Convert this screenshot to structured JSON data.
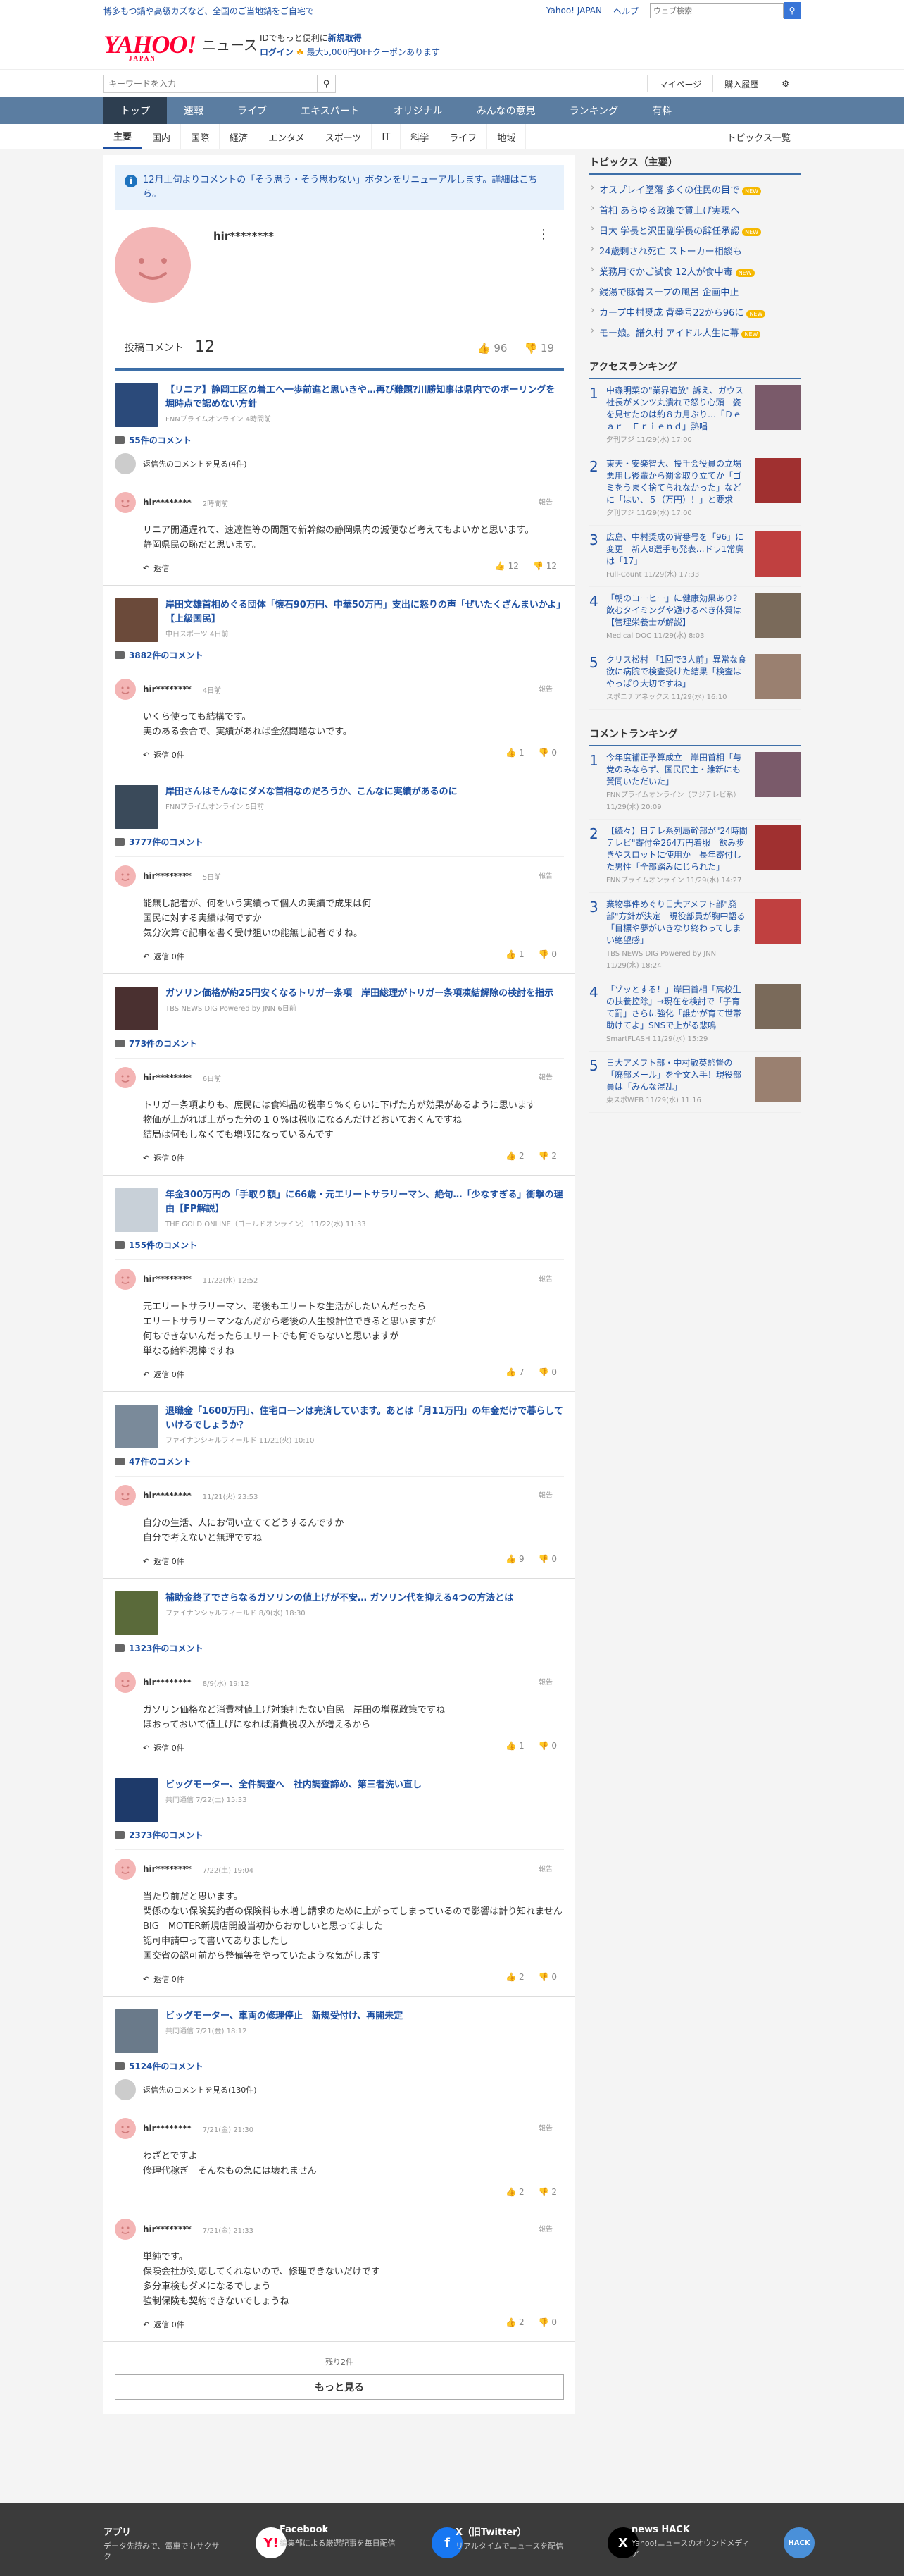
{
  "promo": {
    "left": "博多もつ鍋や高級カズなど、全国のご当地鍋をご自宅で",
    "yahoo_japan": "Yahoo! JAPAN",
    "help": "ヘルプ",
    "search_placeholder": "ウェブ検索"
  },
  "header": {
    "logo": "YAHOO!",
    "logo_sub": "JAPAN",
    "news": "ニュース",
    "line1_a": "IDでもっと便利に",
    "line1_b": "新規取得",
    "login": "ログイン",
    "coupon": "最大5,000円OFFクーポンあります"
  },
  "toolbar": {
    "keyword_placeholder": "キーワードを入力",
    "mypage": "マイページ",
    "history": "購入履歴"
  },
  "gnav": [
    "トップ",
    "速報",
    "ライブ",
    "エキスパート",
    "オリジナル",
    "みんなの意見",
    "ランキング",
    "有料"
  ],
  "subnav": [
    "主要",
    "国内",
    "国際",
    "経済",
    "エンタメ",
    "スポーツ",
    "IT",
    "科学",
    "ライフ",
    "地域"
  ],
  "subnav_right": "トピックス一覧",
  "notice": "12月上旬よりコメントの「そう思う・そう思わない」ボタンをリニューアルします。詳細はこちら。",
  "user": {
    "name": "hir********",
    "count_label": "投稿コメント",
    "count": "12",
    "up": "96",
    "down": "19"
  },
  "articles": [
    {
      "title": "【リニア】静岡工区の着工へ一歩前進と思いきや…再び難題?川勝知事は県内でのボーリングを堀時点で認めない方針",
      "source": "FNNプライムオンライン 4時間前",
      "ccount": "55件のコメント",
      "more": "返信先のコメントを見る(4件)",
      "time": "2時間前",
      "body": "リニア開通遅れて、速達性等の問題で新幹線の静岡県内の減便など考えてもよいかと思います。\n静岡県民の恥だと思います。",
      "reply": "返信",
      "up": "12",
      "down": "12",
      "thumb": "#2b4a7a"
    },
    {
      "title": "岸田文雄首相めぐる団体「懐石90万円、中華50万円」支出に怒りの声「ぜいたくざんまいかよ」【上級国民】",
      "source": "中日スポーツ 4日前",
      "ccount": "3882件のコメント",
      "more": "",
      "time": "4日前",
      "body": "いくら使っても結構です。\n実のある会合で、実績があれば全然問題ないです。",
      "reply": "返信 0件",
      "up": "1",
      "down": "0",
      "thumb": "#6b4a3a"
    },
    {
      "title": "岸田さんはそんなにダメな首相なのだろうか、こんなに実績があるのに",
      "source": "FNNプライムオンライン 5日前",
      "ccount": "3777件のコメント",
      "more": "",
      "time": "5日前",
      "body": "能無し記者が、何をいう実績って個人の実績で成果は何\n国民に対する実績は何ですか\n気分次第で記事を書く受け狙いの能無し記者ですね。",
      "reply": "返信 0件",
      "up": "1",
      "down": "0",
      "thumb": "#3a4a5a"
    },
    {
      "title": "ガソリン価格が約25円安くなるトリガー条項　岸田総理がトリガー条項凍結解除の検討を指示",
      "source": "TBS NEWS DIG Powered by JNN 6日前",
      "ccount": "773件のコメント",
      "more": "",
      "time": "6日前",
      "body": "トリガー条項よりも、庶民には食料品の税率５%くらいに下げた方が効果があるように思います\n物価が上がれば上がった分の１０%は税収になるんだけどおいておくんですね\n結局は何もしなくても増収になっているんです",
      "reply": "返信 0件",
      "up": "2",
      "down": "2",
      "thumb": "#4a3030"
    },
    {
      "title": "年金300万円の「手取り額」に66歳・元エリートサラリーマン、絶句…「少なすぎる」衝撃の理由【FP解説】",
      "source": "THE GOLD ONLINE（ゴールドオンライン） 11/22(水) 11:33",
      "ccount": "155件のコメント",
      "more": "",
      "time": "11/22(水) 12:52",
      "body": "元エリートサラリーマン、老後もエリートな生活がしたいんだったら\nエリートサラリーマンなんだから老後の人生設計位できると思いますが\n何もできないんだったらエリートでも何でもないと思いますが\n単なる給料泥棒ですね",
      "reply": "返信 0件",
      "up": "7",
      "down": "0",
      "thumb": "#c8d0d8"
    },
    {
      "title": "退職金「1600万円」、住宅ローンは完済しています。あとは「月11万円」の年金だけで暮らしていけるでしょうか？",
      "source": "ファイナンシャルフィールド 11/21(火) 10:10",
      "ccount": "47件のコメント",
      "more": "",
      "time": "11/21(火) 23:53",
      "body": "自分の生活、人にお伺い立ててどうするんですか\n自分で考えないと無理ですね",
      "reply": "返信 0件",
      "up": "9",
      "down": "0",
      "thumb": "#7a8a9a"
    },
    {
      "title": "補助金終了でさらなるガソリンの値上げが不安… ガソリン代を抑える4つの方法とは",
      "source": "ファイナンシャルフィールド 8/9(水) 18:30",
      "ccount": "1323件のコメント",
      "more": "",
      "time": "8/9(水) 19:12",
      "body": "ガソリン価格など消費材値上げ対策打たない自民　岸田の増税政策ですね\nほおっておいて値上げになれば消費税収入が増えるから",
      "reply": "返信 0件",
      "up": "1",
      "down": "0",
      "thumb": "#5a6a3a"
    },
    {
      "title": "ビッグモーター、全件調査へ　社内調査諦め、第三者洗い直し",
      "source": "共同通信 7/22(土) 15:33",
      "ccount": "2373件のコメント",
      "more": "",
      "time": "7/22(土) 19:04",
      "body": "当たり前だと思います。\n関係のない保険契約者の保険料も水増し請求のために上がってしまっているので影響は計り知れません\nBIG　MOTER新規店開設当初からおかしいと思ってました\n認可申請中って書いてありましたし\n国交省の認可前から整備等をやっていたような気がします",
      "reply": "返信 0件",
      "up": "2",
      "down": "0",
      "thumb": "#1e3a6a"
    },
    {
      "title": "ビッグモーター、車両の修理停止　新規受付け、再開未定",
      "source": "共同通信 7/21(金) 18:12",
      "ccount": "5124件のコメント",
      "more": "返信先のコメントを見る(130件)",
      "time": "7/21(金) 21:30",
      "body": "わざとですよ\n修理代稼ぎ　そんなもの急には壊れません",
      "reply": "",
      "up": "2",
      "down": "2",
      "thumb": "#6a7a8a",
      "extra": {
        "time": "7/21(金) 21:33",
        "body": "単純です。\n保険会社が対応してくれないので、修理できないだけです\n多分車検もダメになるでしょう\n強制保険も契約できないでしょうね",
        "reply": "返信 0件",
        "up": "2",
        "down": "0"
      }
    }
  ],
  "report": "報告",
  "remain": "残り2件",
  "more_btn": "もっと見る",
  "topics": {
    "title": "トピックス（主要）",
    "items": [
      "オスプレイ墜落 多くの住民の目で",
      "首相 あらゆる政策で賃上げ実現へ",
      "日大 学長と沢田副学長の辞任承認",
      "24歳刺され死亡 ストーカー相談も",
      "業務用でかご試食 12人が食中毒",
      "銭湯で豚骨スープの風呂 企画中止",
      "カープ中村奨成 背番号22から96に",
      "モー娘。譜久村 アイドル人生に幕"
    ],
    "new": [
      0,
      2,
      4,
      6,
      7
    ]
  },
  "access": {
    "title": "アクセスランキング",
    "items": [
      {
        "t": "中森明菜の\"業界追放\" 訴え、ガウス社長がメンツ丸潰れで怒り心頭　姿を見せたのは約８カ月ぶり…「Ｄｅａｒ　Ｆｒｉｅｎｄ」熱唱",
        "s": "夕刊フジ 11/29(水) 17:00"
      },
      {
        "t": "東天・安楽智大、投手会役員の立場悪用し後輩から罰金取り立てか「ゴミをうまく捨てられなかった」などに「はい、５（万円）！」と要求",
        "s": "夕刊フジ 11/29(水) 17:00"
      },
      {
        "t": "広島、中村奨成の背番号を「96」に変更　新人8選手も発表…ドラ1常廣は「17」",
        "s": "Full-Count 11/29(水) 17:33"
      },
      {
        "t": "「朝のコーヒー」に健康効果あり？ 飲むタイミングや避けるべき体質は【管理栄養士が解説】",
        "s": "Medical DOC 11/29(水) 8:03"
      },
      {
        "t": "クリス松村 「1回で3人前」異常な食欲に病院で検査受けた結果「検査はやっぱり大切ですね」",
        "s": "スポニチアネックス 11/29(水) 16:10"
      }
    ]
  },
  "commentrank": {
    "title": "コメントランキング",
    "items": [
      {
        "t": "今年度補正予算成立　岸田首相「与党のみならず、国民民主・維新にも賛同いただいた」",
        "s": "FNNプライムオンライン（フジテレビ系） 11/29(水) 20:09"
      },
      {
        "t": "【続々】日テレ系列局幹部が\"24時間テレビ\"寄付金264万円着服　飲み歩きやスロットに使用か　長年寄付した男性「全部踏みにじられた」",
        "s": "FNNプライムオンライン 11/29(水) 14:27"
      },
      {
        "t": "業物事件めぐり日大アメフト部\"廃部\"方針が決定　現役部員が胸中語る「目標や夢がいきなり終わってしまい絶望感」",
        "s": "TBS NEWS DIG Powered by JNN 11/29(水) 18:24"
      },
      {
        "t": "「ゾッとする！」岸田首相「高校生の扶養控除」→現在を検討で「子育て罰」さらに強化「誰かが育て世帯助けてよ」SNSで上がる悲鳴",
        "s": "SmartFLASH 11/29(水) 15:29"
      },
      {
        "t": "日大アメフト部・中村敏英監督の「廃部メール」を全文入手！現役部員は「みんな混乱」",
        "s": "東スポWEB 11/29(水) 11:16"
      }
    ]
  },
  "footer": [
    {
      "t": "アプリ",
      "d": "データ先読みで、電車でもサクサク"
    },
    {
      "t": "Facebook",
      "d": "編集部による厳選記事を毎日配信"
    },
    {
      "t": "X（旧Twitter）",
      "d": "リアルタイムでニュースを配信"
    },
    {
      "t": "news HACK",
      "d": "Yahoo!ニュースのオウンドメディア"
    }
  ]
}
